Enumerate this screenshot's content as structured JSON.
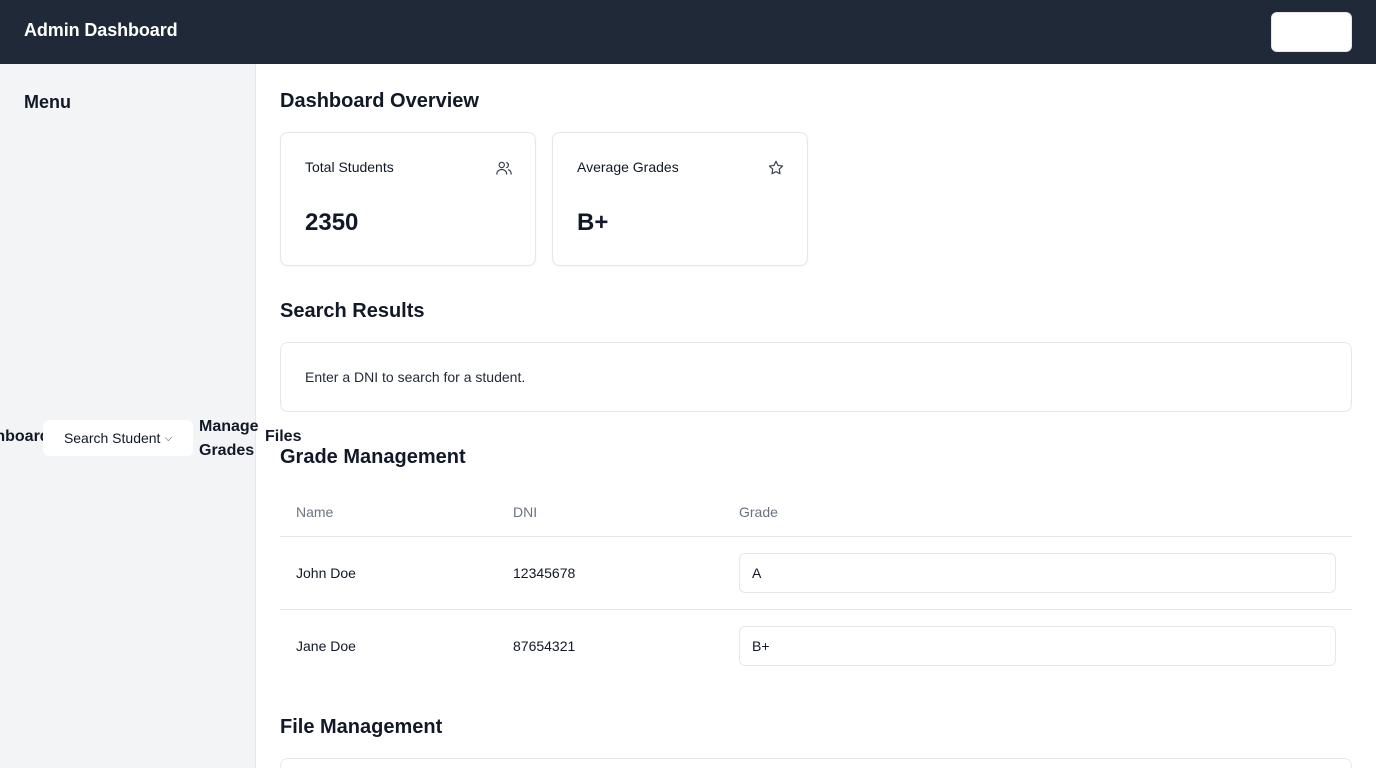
{
  "header": {
    "title": "Admin Dashboard",
    "user_button_label": ""
  },
  "sidebar": {
    "title": "Menu",
    "items": [
      {
        "label": "Dashboard"
      },
      {
        "label": "Search Student",
        "icon": "chevron-down-icon"
      },
      {
        "label": "Manage Grades"
      },
      {
        "label": "Files"
      }
    ]
  },
  "overview": {
    "heading": "Dashboard Overview",
    "cards": [
      {
        "label": "Total Students",
        "value": "2350",
        "icon": "users-icon"
      },
      {
        "label": "Average Grades",
        "value": "B+",
        "icon": "star-icon"
      }
    ]
  },
  "search_results": {
    "heading": "Search Results",
    "message": "Enter a DNI to search for a student."
  },
  "grade_management": {
    "heading": "Grade Management",
    "columns": [
      "Name",
      "DNI",
      "Grade"
    ],
    "rows": [
      {
        "name": "John Doe",
        "dni": "12345678",
        "grade": "A"
      },
      {
        "name": "Jane Doe",
        "dni": "87654321",
        "grade": "B+"
      }
    ]
  },
  "file_management": {
    "heading": "File Management"
  },
  "colors": {
    "header_bg": "#1f2937",
    "sidebar_bg": "#f3f4f6",
    "border": "#e5e7eb"
  }
}
